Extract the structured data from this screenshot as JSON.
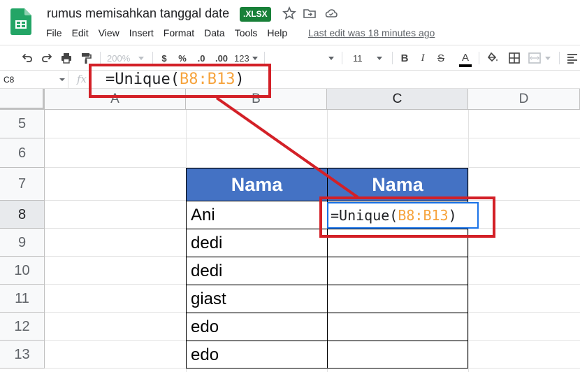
{
  "header": {
    "doc_title": "rumus memisahkan tanggal date",
    "badge": ".XLSX",
    "menu": [
      "File",
      "Edit",
      "View",
      "Insert",
      "Format",
      "Data",
      "Tools",
      "Help"
    ],
    "last_edit": "Last edit was 18 minutes ago"
  },
  "toolbar": {
    "zoom": "200%",
    "currency": "$",
    "percent": "%",
    "decrease_decimal": ".0",
    "increase_decimal": ".00",
    "number_format": "123",
    "font_size": "11",
    "bold": "B",
    "italic": "I",
    "strikethrough": "S",
    "text_color": "A"
  },
  "formula_bar": {
    "name_box": "C8",
    "fx": "fx",
    "formula_prefix": "=Unique",
    "formula_open": "(",
    "formula_ref": "B8:B13",
    "formula_close": ")"
  },
  "grid": {
    "columns": [
      "A",
      "B",
      "C",
      "D"
    ],
    "rows": [
      "5",
      "6",
      "7",
      "8",
      "9",
      "10",
      "11",
      "12",
      "13"
    ],
    "selected_column": "C",
    "selected_row": "8"
  },
  "table": {
    "header_b": "Nama",
    "header_c": "Nama",
    "names": [
      "Ani",
      "dedi",
      "dedi",
      "giast",
      "edo",
      "edo"
    ]
  },
  "active_cell": {
    "prefix": "=Unique",
    "open": "(",
    "ref": "B8:B13",
    "close": ")"
  },
  "colors": {
    "table_header": "#4472c4",
    "annotation": "#d32027",
    "range_ref": "#f6a33c",
    "selection": "#1a73e8",
    "badge": "#188038"
  }
}
